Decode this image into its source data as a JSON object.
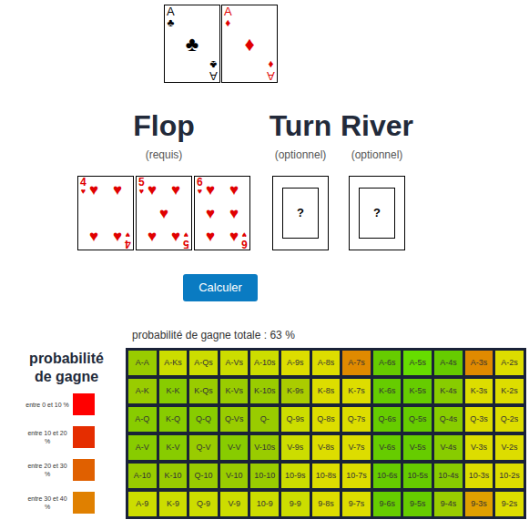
{
  "hole_cards": [
    {
      "rank": "A",
      "suit": "♣",
      "color": "#000000"
    },
    {
      "rank": "A",
      "suit": "♦",
      "color": "#e00000"
    }
  ],
  "streets": [
    {
      "title": "Flop",
      "subtitle": "(requis)",
      "kind": "cards",
      "cards": [
        {
          "rank": "4",
          "suit": "♥",
          "color": "#e00000"
        },
        {
          "rank": "5",
          "suit": "♥",
          "color": "#e00000"
        },
        {
          "rank": "6",
          "suit": "♥",
          "color": "#e00000"
        }
      ]
    },
    {
      "title": "Turn",
      "subtitle": "(optionnel)",
      "kind": "empty",
      "placeholder": "?"
    },
    {
      "title": "River",
      "subtitle": "(optionnel)",
      "kind": "empty",
      "placeholder": "?"
    }
  ],
  "button": "Calculer",
  "total": "probabilité de gagne totale : 63 %",
  "legend": {
    "title": "probabilité de gagne",
    "items": [
      {
        "label": "entre 0 et 10 %",
        "color": "#ff0000"
      },
      {
        "label": "entre 10 et 20 %",
        "color": "#e52d00"
      },
      {
        "label": "entre 20 et 30 %",
        "color": "#e06000"
      },
      {
        "label": "entre 30 et 40 %",
        "color": "#e08000"
      }
    ]
  },
  "grid": [
    [
      {
        "label": "A-A",
        "color": "#99cc00"
      },
      {
        "label": "A-Ks",
        "color": "#ccdd00"
      },
      {
        "label": "A-Qs",
        "color": "#ccdd00"
      },
      {
        "label": "A-Vs",
        "color": "#ccdd00"
      },
      {
        "label": "A-10s",
        "color": "#ccdd00"
      },
      {
        "label": "A-9s",
        "color": "#dddd00"
      },
      {
        "label": "A-8s",
        "color": "#dddd00"
      },
      {
        "label": "A-7s",
        "color": "#e08a00"
      },
      {
        "label": "A-6s",
        "color": "#66cc00"
      },
      {
        "label": "A-5s",
        "color": "#66dd00"
      },
      {
        "label": "A-4s",
        "color": "#66cc00"
      },
      {
        "label": "A-3s",
        "color": "#e08a00"
      },
      {
        "label": "A-2s",
        "color": "#dddd00"
      }
    ],
    [
      {
        "label": "A-K",
        "color": "#99cc00"
      },
      {
        "label": "K-K",
        "color": "#88cc00"
      },
      {
        "label": "K-Qs",
        "color": "#99cc00"
      },
      {
        "label": "K-Vs",
        "color": "#99cc00"
      },
      {
        "label": "K-10s",
        "color": "#99cc00"
      },
      {
        "label": "K-9s",
        "color": "#aacc00"
      },
      {
        "label": "K-8s",
        "color": "#dddd00"
      },
      {
        "label": "K-7s",
        "color": "#dddd00"
      },
      {
        "label": "K-6s",
        "color": "#66cc00"
      },
      {
        "label": "K-5s",
        "color": "#66cc00"
      },
      {
        "label": "K-4s",
        "color": "#88cc00"
      },
      {
        "label": "K-3s",
        "color": "#dddd00"
      },
      {
        "label": "K-2s",
        "color": "#dddd00"
      }
    ],
    [
      {
        "label": "A-Q",
        "color": "#88cc00"
      },
      {
        "label": "K-Q",
        "color": "#88cc00"
      },
      {
        "label": "Q-Q",
        "color": "#88cc00"
      },
      {
        "label": "Q-Vs",
        "color": "#99cc00"
      },
      {
        "label": "Q-",
        "color": "#99cc00"
      },
      {
        "label": "Q-9s",
        "color": "#ccdd00"
      },
      {
        "label": "Q-8s",
        "color": "#dddd00"
      },
      {
        "label": "Q-7s",
        "color": "#dddd00"
      },
      {
        "label": "Q-6s",
        "color": "#66cc00"
      },
      {
        "label": "Q-5s",
        "color": "#66cc00"
      },
      {
        "label": "Q-4s",
        "color": "#88cc00"
      },
      {
        "label": "Q-3s",
        "color": "#dddd00"
      },
      {
        "label": "Q-2s",
        "color": "#dddd00"
      }
    ],
    [
      {
        "label": "A-V",
        "color": "#88cc00"
      },
      {
        "label": "K-V",
        "color": "#88cc00"
      },
      {
        "label": "Q-V",
        "color": "#99cc00"
      },
      {
        "label": "V-V",
        "color": "#88cc00"
      },
      {
        "label": "V-10s",
        "color": "#99cc00"
      },
      {
        "label": "V-9s",
        "color": "#ccdd00"
      },
      {
        "label": "V-8s",
        "color": "#dddd00"
      },
      {
        "label": "V-7s",
        "color": "#dddd00"
      },
      {
        "label": "V-6s",
        "color": "#66cc00"
      },
      {
        "label": "V-5s",
        "color": "#66cc00"
      },
      {
        "label": "V-4s",
        "color": "#88cc00"
      },
      {
        "label": "V-3s",
        "color": "#dddd00"
      },
      {
        "label": "V-2s",
        "color": "#dddd00"
      }
    ],
    [
      {
        "label": "A-10",
        "color": "#99cc00"
      },
      {
        "label": "K-10",
        "color": "#99cc00"
      },
      {
        "label": "Q-10",
        "color": "#99cc00"
      },
      {
        "label": "V-10",
        "color": "#99cc00"
      },
      {
        "label": "10-10",
        "color": "#99cc00"
      },
      {
        "label": "10-9s",
        "color": "#ccdd00"
      },
      {
        "label": "10-8s",
        "color": "#dddd00"
      },
      {
        "label": "10-7s",
        "color": "#dddd00"
      },
      {
        "label": "10-6s",
        "color": "#66cc00"
      },
      {
        "label": "10-5s",
        "color": "#66cc00"
      },
      {
        "label": "10-4s",
        "color": "#88cc00"
      },
      {
        "label": "10-3s",
        "color": "#dddd00"
      },
      {
        "label": "10-2s",
        "color": "#dddd00"
      }
    ],
    [
      {
        "label": "A-9",
        "color": "#ccdd00"
      },
      {
        "label": "K-9",
        "color": "#ccdd00"
      },
      {
        "label": "Q-9",
        "color": "#ccdd00"
      },
      {
        "label": "V-9",
        "color": "#ccdd00"
      },
      {
        "label": "10-9",
        "color": "#ccdd00"
      },
      {
        "label": "9-9",
        "color": "#ccdd00"
      },
      {
        "label": "9-8s",
        "color": "#dddd00"
      },
      {
        "label": "9-7s",
        "color": "#dddd00"
      },
      {
        "label": "9-6s",
        "color": "#66cc00"
      },
      {
        "label": "9-5s",
        "color": "#66cc00"
      },
      {
        "label": "9-4s",
        "color": "#99cc00"
      },
      {
        "label": "9-3s",
        "color": "#e0a000"
      },
      {
        "label": "9-2s",
        "color": "#dddd00"
      }
    ]
  ]
}
